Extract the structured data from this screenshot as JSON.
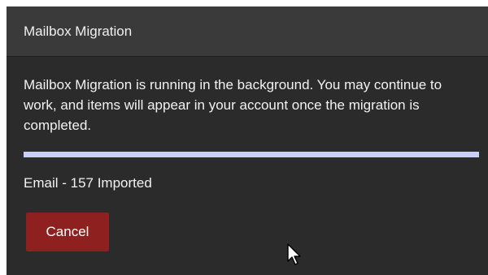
{
  "dialog": {
    "title": "Mailbox Migration",
    "message": "Mailbox Migration is running in the background. You may continue to work, and items will appear in your account once the migration is completed.",
    "progress": 1.0,
    "progress_color": "#c9cff6",
    "status": "Email - 157 Imported",
    "cancel_label": "Cancel",
    "cancel_color": "#8e2020"
  },
  "cursor": {
    "icon": "arrow-pointer-icon"
  }
}
